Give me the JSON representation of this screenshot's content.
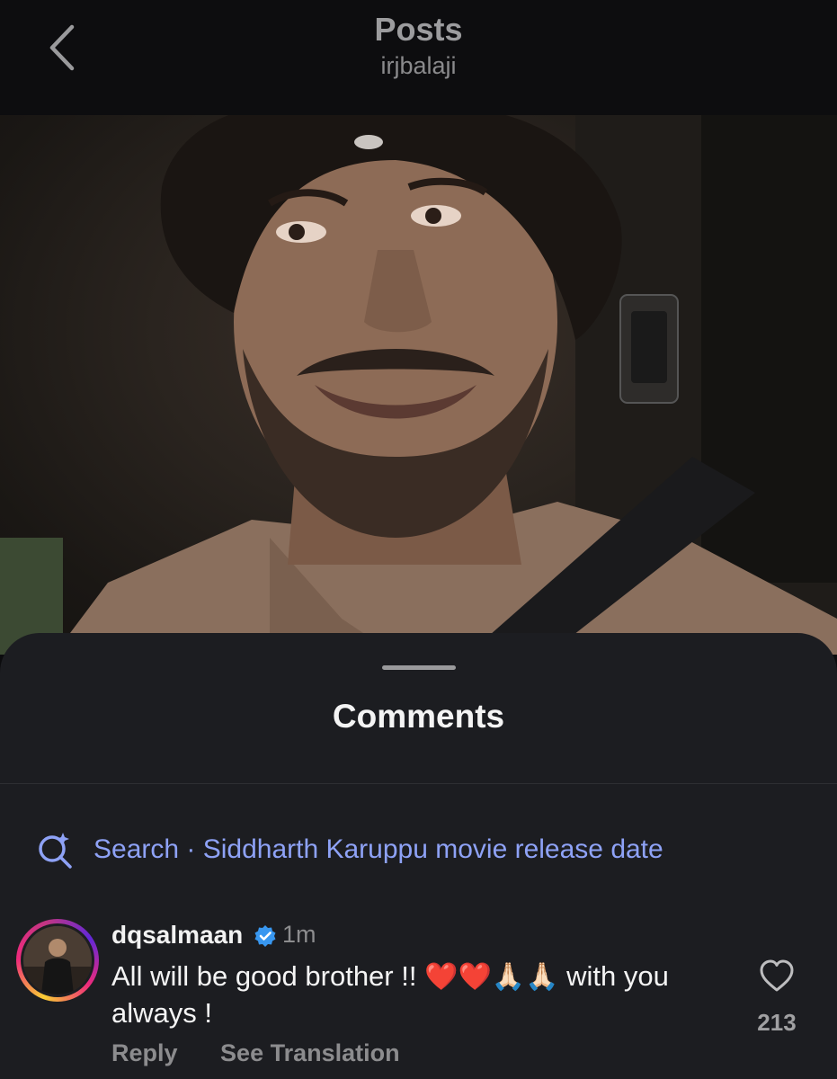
{
  "header": {
    "title": "Posts",
    "subtitle": "irjbalaji",
    "back_icon": "chevron-left-icon"
  },
  "sheet": {
    "title": "Comments"
  },
  "search": {
    "icon": "sparkle-search-icon",
    "text": "Search · Siddharth Karuppu movie release date"
  },
  "comment": {
    "username": "dqsalmaan",
    "verified": true,
    "time": "1m",
    "text_before": "All will be good brother !!",
    "emojis": "❤️❤️🙏🏻🙏🏻",
    "text_after": "with you always !",
    "reply_label": "Reply",
    "translate_label": "See Translation",
    "likes": "213",
    "like_icon": "heart-outline-icon"
  },
  "colors": {
    "accent_search": "#8ea2f6",
    "verified_blue": "#3897f0",
    "sheet_bg": "#1c1d21"
  }
}
